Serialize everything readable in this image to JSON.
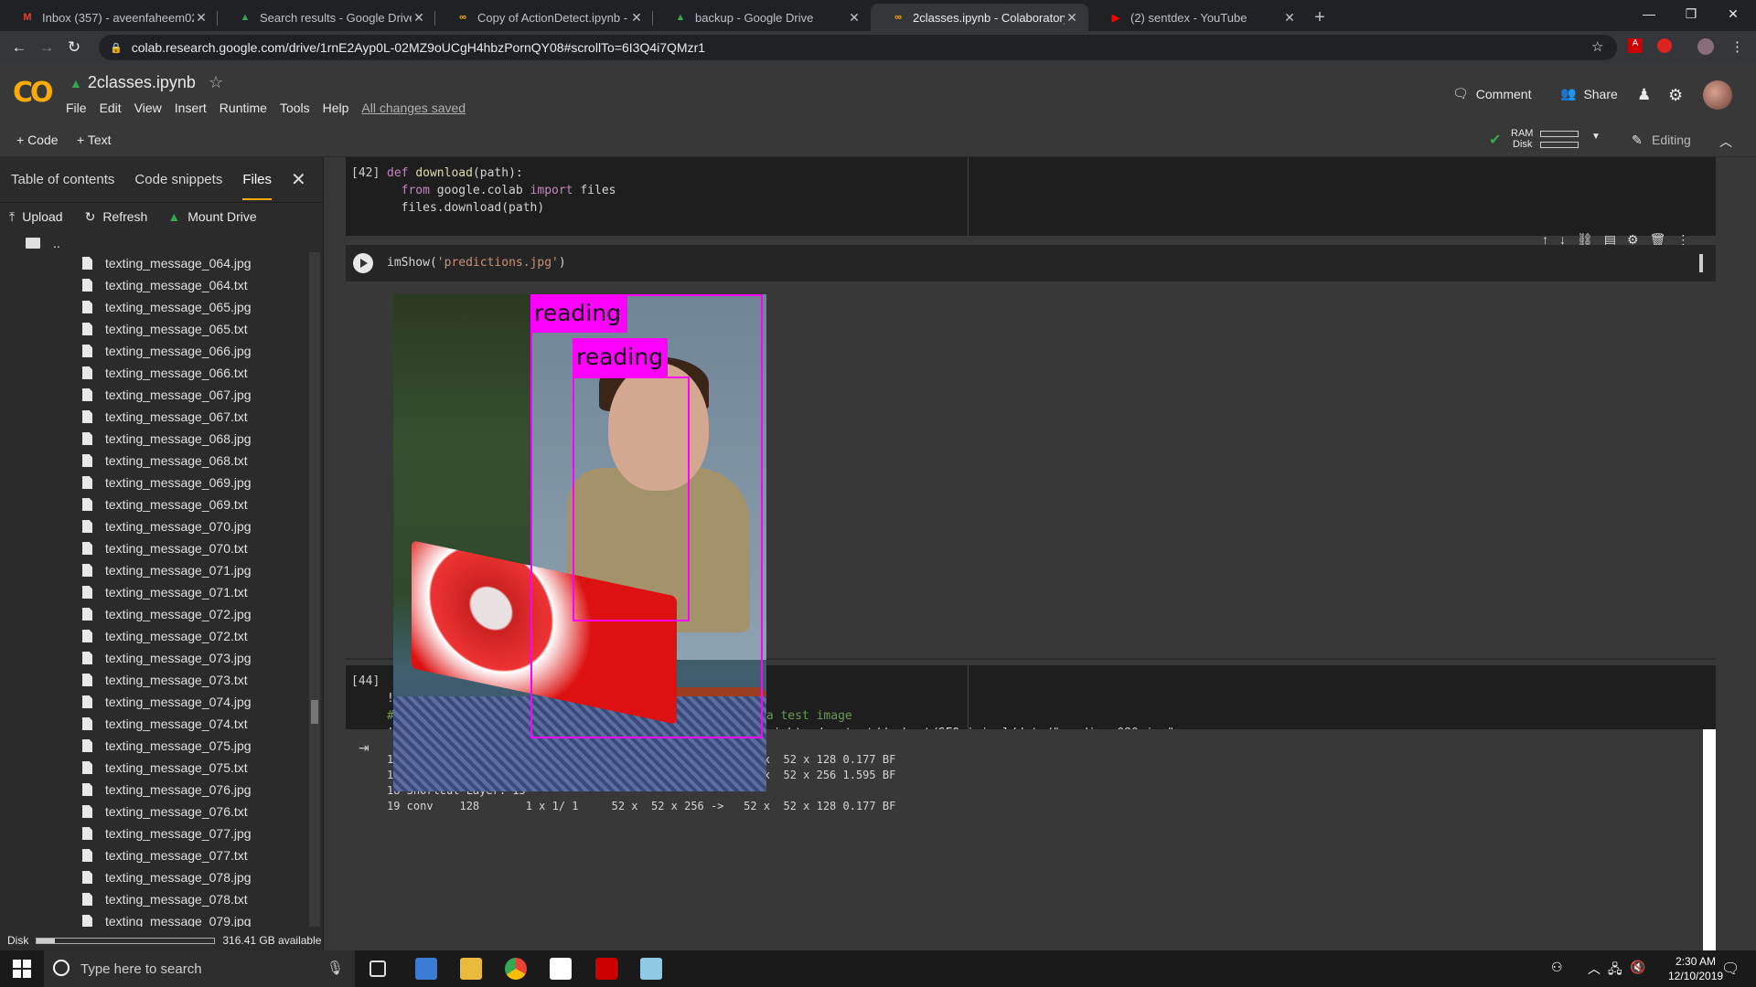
{
  "browser": {
    "tabs": [
      {
        "title": "Inbox (357) - aveenfaheem02@g",
        "icon": "gmail-icon",
        "color": "#ea4335"
      },
      {
        "title": "Search results - Google Drive",
        "icon": "drive-icon",
        "color": "#34a853"
      },
      {
        "title": "Copy of ActionDetect.ipynb - Col",
        "icon": "colab-icon",
        "color": "#f9ab00"
      },
      {
        "title": "backup - Google Drive",
        "icon": "drive-icon",
        "color": "#34a853"
      },
      {
        "title": "2classes.ipynb - Colaboratory",
        "icon": "colab-icon",
        "color": "#f9ab00",
        "active": true
      },
      {
        "title": "(2) sentdex - YouTube",
        "icon": "youtube-icon",
        "color": "#ff0000"
      }
    ],
    "new_tab": "+",
    "url": "colab.research.google.com/drive/1rnE2Ayp0L-02MZ9oUCgH4hbzPornQY08#scrollTo=6I3Q4i7QMzr1"
  },
  "colab": {
    "logo": "CO",
    "notebook_name": "2classes.ipynb",
    "menu": [
      "File",
      "Edit",
      "View",
      "Insert",
      "Runtime",
      "Tools",
      "Help"
    ],
    "save_status": "All changes saved",
    "comment_label": "Comment",
    "share_label": "Share",
    "toolbar": {
      "add_code": "+ Code",
      "add_text": "+ Text",
      "ram": "RAM",
      "disk": "Disk",
      "editing": "Editing"
    }
  },
  "sidebar": {
    "tabs": [
      "Table of contents",
      "Code snippets",
      "Files"
    ],
    "actions": {
      "upload": "Upload",
      "refresh": "Refresh",
      "mount": "Mount Drive"
    },
    "parent_dir": "..",
    "files": [
      "texting_message_064.jpg",
      "texting_message_064.txt",
      "texting_message_065.jpg",
      "texting_message_065.txt",
      "texting_message_066.jpg",
      "texting_message_066.txt",
      "texting_message_067.jpg",
      "texting_message_067.txt",
      "texting_message_068.jpg",
      "texting_message_068.txt",
      "texting_message_069.jpg",
      "texting_message_069.txt",
      "texting_message_070.jpg",
      "texting_message_070.txt",
      "texting_message_071.jpg",
      "texting_message_071.txt",
      "texting_message_072.jpg",
      "texting_message_072.txt",
      "texting_message_073.jpg",
      "texting_message_073.txt",
      "texting_message_074.jpg",
      "texting_message_074.txt",
      "texting_message_075.jpg",
      "texting_message_075.txt",
      "texting_message_076.jpg",
      "texting_message_076.txt",
      "texting_message_077.jpg",
      "texting_message_077.txt",
      "texting_message_078.jpg",
      "texting_message_078.txt",
      "texting_message_079.jpg"
    ],
    "disk_label": "Disk",
    "disk_available": "316.41 GB available",
    "disk_used_fraction": 0.1
  },
  "cells": {
    "c42": {
      "exec": "[42]",
      "lines": [
        "def download(path):",
        "  from google.colab import files",
        "  files.download(path)"
      ]
    },
    "c43": {
      "code": "imShow('predictions.jpg')",
      "labels": [
        "reading",
        "reading"
      ]
    },
    "c44": {
      "exec": "[44]",
      "line1": "!ls",
      "line2": "#Now, let's see if everything works by running it on a test image",
      "line3": "!./darknet detect SFOriginal/yolov3.cfg yolov3_1660.weights /content/darknet/SFOriginal/data/\"reading_080.jpg\"",
      "output": [
        "16 conv    128       1 x 1/ 1     52 x  52 x 256 ->   52 x  52 x 128 0.177 BF",
        "17 conv    256       3 x 3/ 1     52 x  52 x 128 ->   52 x  52 x 256 1.595 BF",
        "18 Shortcut Layer: 15",
        "19 conv    128       1 x 1/ 1     52 x  52 x 256 ->   52 x  52 x 128 0.177 BF"
      ]
    }
  },
  "taskbar": {
    "search_placeholder": "Type here to search",
    "time": "2:30 AM",
    "date": "12/10/2019"
  }
}
